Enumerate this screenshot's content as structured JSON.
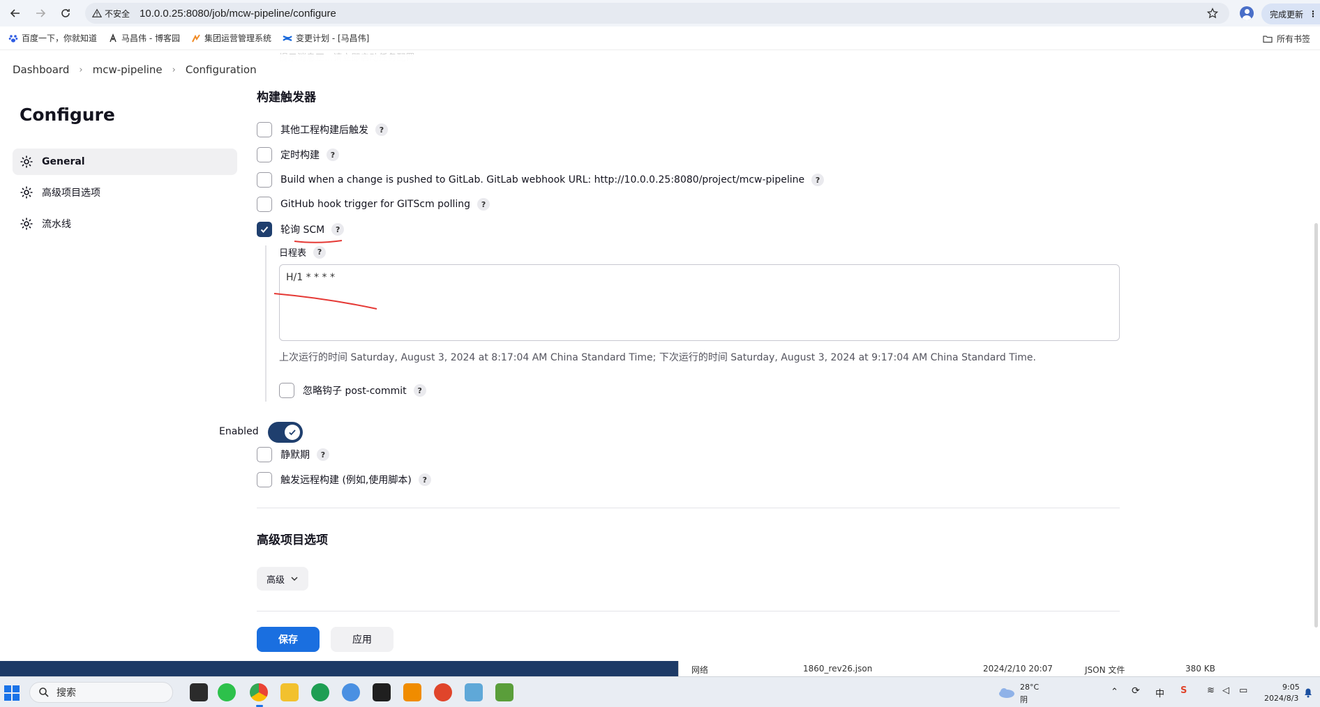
{
  "browser": {
    "insecure_label": "不安全",
    "url": "10.0.0.25:8080/job/mcw-pipeline/configure",
    "update_label": "完成更新",
    "bookmarks": [
      "百度一下，你就知道",
      "马昌伟 - 博客园",
      "集团运营管理系统",
      "变更计划 - [马昌伟]"
    ],
    "all_bookmarks": "所有书签"
  },
  "breadcrumb": [
    "Dashboard",
    "mcw-pipeline",
    "Configuration"
  ],
  "ghost_text": "提示消息正...请立即启动任务配置",
  "sidebar": {
    "title": "Configure",
    "items": [
      {
        "label": "General",
        "icon": "gear-icon"
      },
      {
        "label": "高级项目选项",
        "icon": "gear-icon"
      },
      {
        "label": "流水线",
        "icon": "gear-icon"
      }
    ]
  },
  "triggers": {
    "title": "构建触发器",
    "options": [
      {
        "label": "其他工程构建后触发",
        "checked": false
      },
      {
        "label": "定时构建",
        "checked": false
      },
      {
        "label": "Build when a change is pushed to GitLab. GitLab webhook URL: http://10.0.0.25:8080/project/mcw-pipeline",
        "checked": false
      },
      {
        "label": "GitHub hook trigger for GITScm polling",
        "checked": false
      },
      {
        "label": "轮询 SCM",
        "checked": true
      }
    ],
    "schedule_label": "日程表",
    "schedule_value": "H/1 * * * *",
    "schedule_info": "上次运行的时间 Saturday, August 3, 2024 at 8:17:04 AM China Standard Time; 下次运行的时间 Saturday, August 3, 2024 at 9:17:04 AM China Standard Time.",
    "ignore_post_commit": "忽略钩子 post-commit",
    "enabled_label": "Enabled",
    "more_options": [
      {
        "label": "静默期",
        "checked": false
      },
      {
        "label": "触发远程构建 (例如,使用脚本)",
        "checked": false
      }
    ]
  },
  "advanced": {
    "title": "高级项目选项",
    "button": "高级"
  },
  "actions": {
    "save": "保存",
    "apply": "应用"
  },
  "explorer_row": {
    "name": "1860_rev26.json",
    "date": "2024/2/10 20:07",
    "type": "JSON 文件",
    "size": "380 KB",
    "left_label": "网络"
  },
  "taskbar": {
    "search": "搜索",
    "weather_temp": "28°C",
    "weather_desc": "阴",
    "time": "9:05",
    "date": "2024/8/3",
    "ime": "中"
  },
  "colors": {
    "accent": "#1a6fe0",
    "toggle": "#1f3f6e",
    "annotation": "#e53935"
  }
}
